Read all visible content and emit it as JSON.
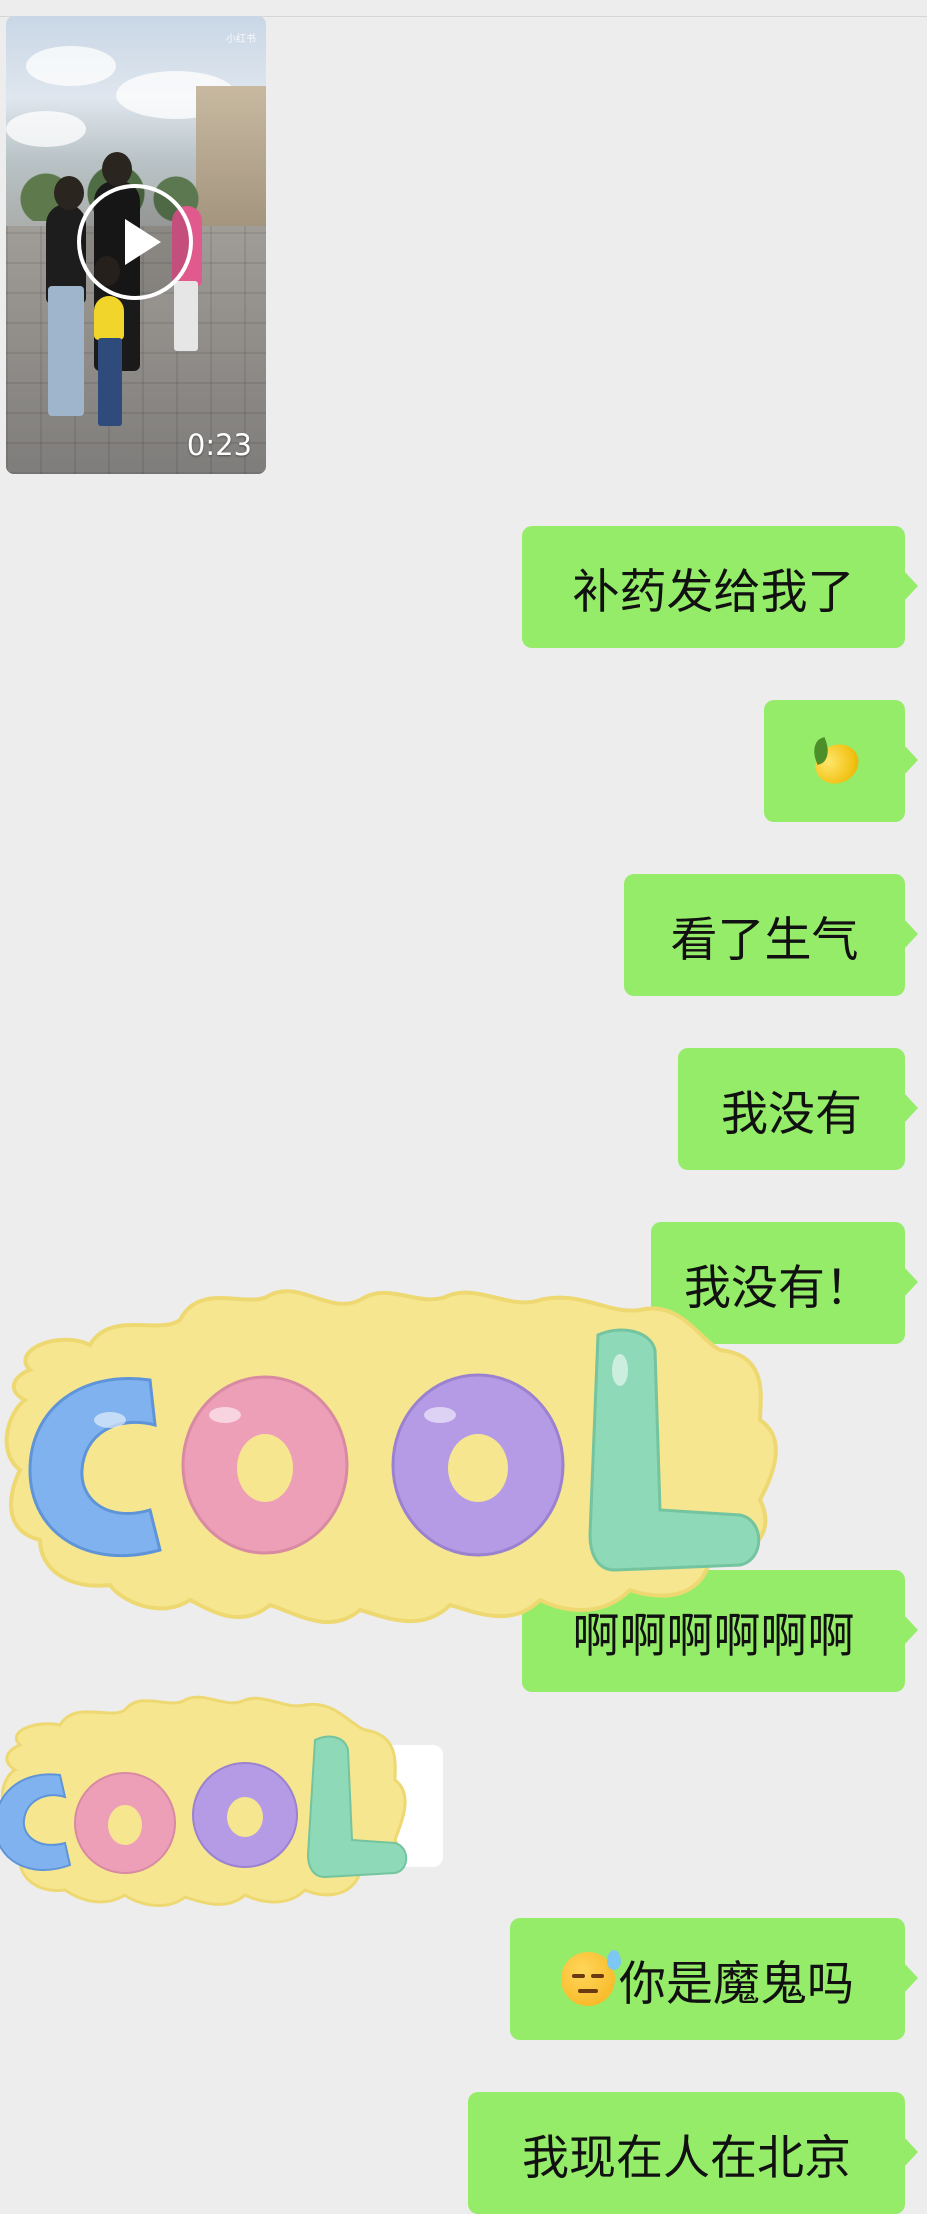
{
  "video": {
    "duration": "0:23",
    "watermark": "小红书",
    "icon": "play-icon"
  },
  "messages": [
    {
      "text": "补药发给我了"
    },
    {
      "emoji": "lemon"
    },
    {
      "text": "看了生气"
    },
    {
      "text": "我没有"
    },
    {
      "text": "我没有！"
    },
    {
      "text": "啊啊啊啊啊啊"
    },
    {
      "emoji": "sweat-face",
      "text": "你是魔鬼吗"
    },
    {
      "text": "我现在人在北京"
    }
  ],
  "stickers": [
    {
      "text": "COOL",
      "letters": [
        "C",
        "O",
        "O",
        "L"
      ],
      "letter_colors": [
        "#7fb2ee",
        "#ee9fb8",
        "#b59be6",
        "#8ed9b7"
      ],
      "backdrop_color": "#f6e68f"
    },
    {
      "text": "COOL",
      "letters": [
        "C",
        "O",
        "O",
        "L"
      ],
      "letter_colors": [
        "#7fb2ee",
        "#ee9fb8",
        "#b59be6",
        "#8ed9b7"
      ],
      "backdrop_color": "#f6e68f"
    }
  ],
  "colors": {
    "background": "#ededed",
    "sent_bubble": "#95ec69",
    "received_bubble": "#ffffff"
  }
}
